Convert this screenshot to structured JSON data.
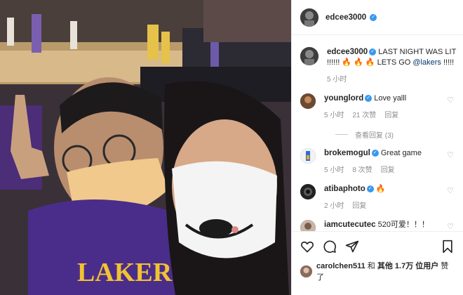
{
  "post": {
    "author": "edcee3000",
    "caption": {
      "username": "edcee3000",
      "text": "LAST NIGHT WAS LIT !!!!!! 🔥 🔥 🔥  LETS GO ",
      "mention": "@lakers",
      "suffix": " !!!!!",
      "time": "5 小时"
    },
    "comments": [
      {
        "username": "younglord",
        "verified": true,
        "text": "Love yalll",
        "time": "5 小时",
        "likes": "21 次赞",
        "reply": "回复",
        "view_replies": "查看回复 (3)"
      },
      {
        "username": "brokemogul",
        "verified": true,
        "text": "Great game",
        "time": "5 小时",
        "likes": "8 次赞",
        "reply": "回复"
      },
      {
        "username": "atibaphoto",
        "verified": true,
        "text": "🔥",
        "time": "2 小时",
        "reply": "回复"
      },
      {
        "username": "iamcutecutec",
        "verified": false,
        "text": "520可爱！！！"
      }
    ],
    "likes": {
      "username": "carolchen511",
      "and": " 和 ",
      "others": "其他 1.7万 位用户",
      "liked": " 赞了"
    }
  },
  "colors": {
    "verified": "#3897f0",
    "link": "#00376b",
    "muted": "#8e8e8e"
  },
  "icons": [
    "heart-icon",
    "comment-icon",
    "share-icon",
    "bookmark-icon",
    "verified-icon"
  ]
}
